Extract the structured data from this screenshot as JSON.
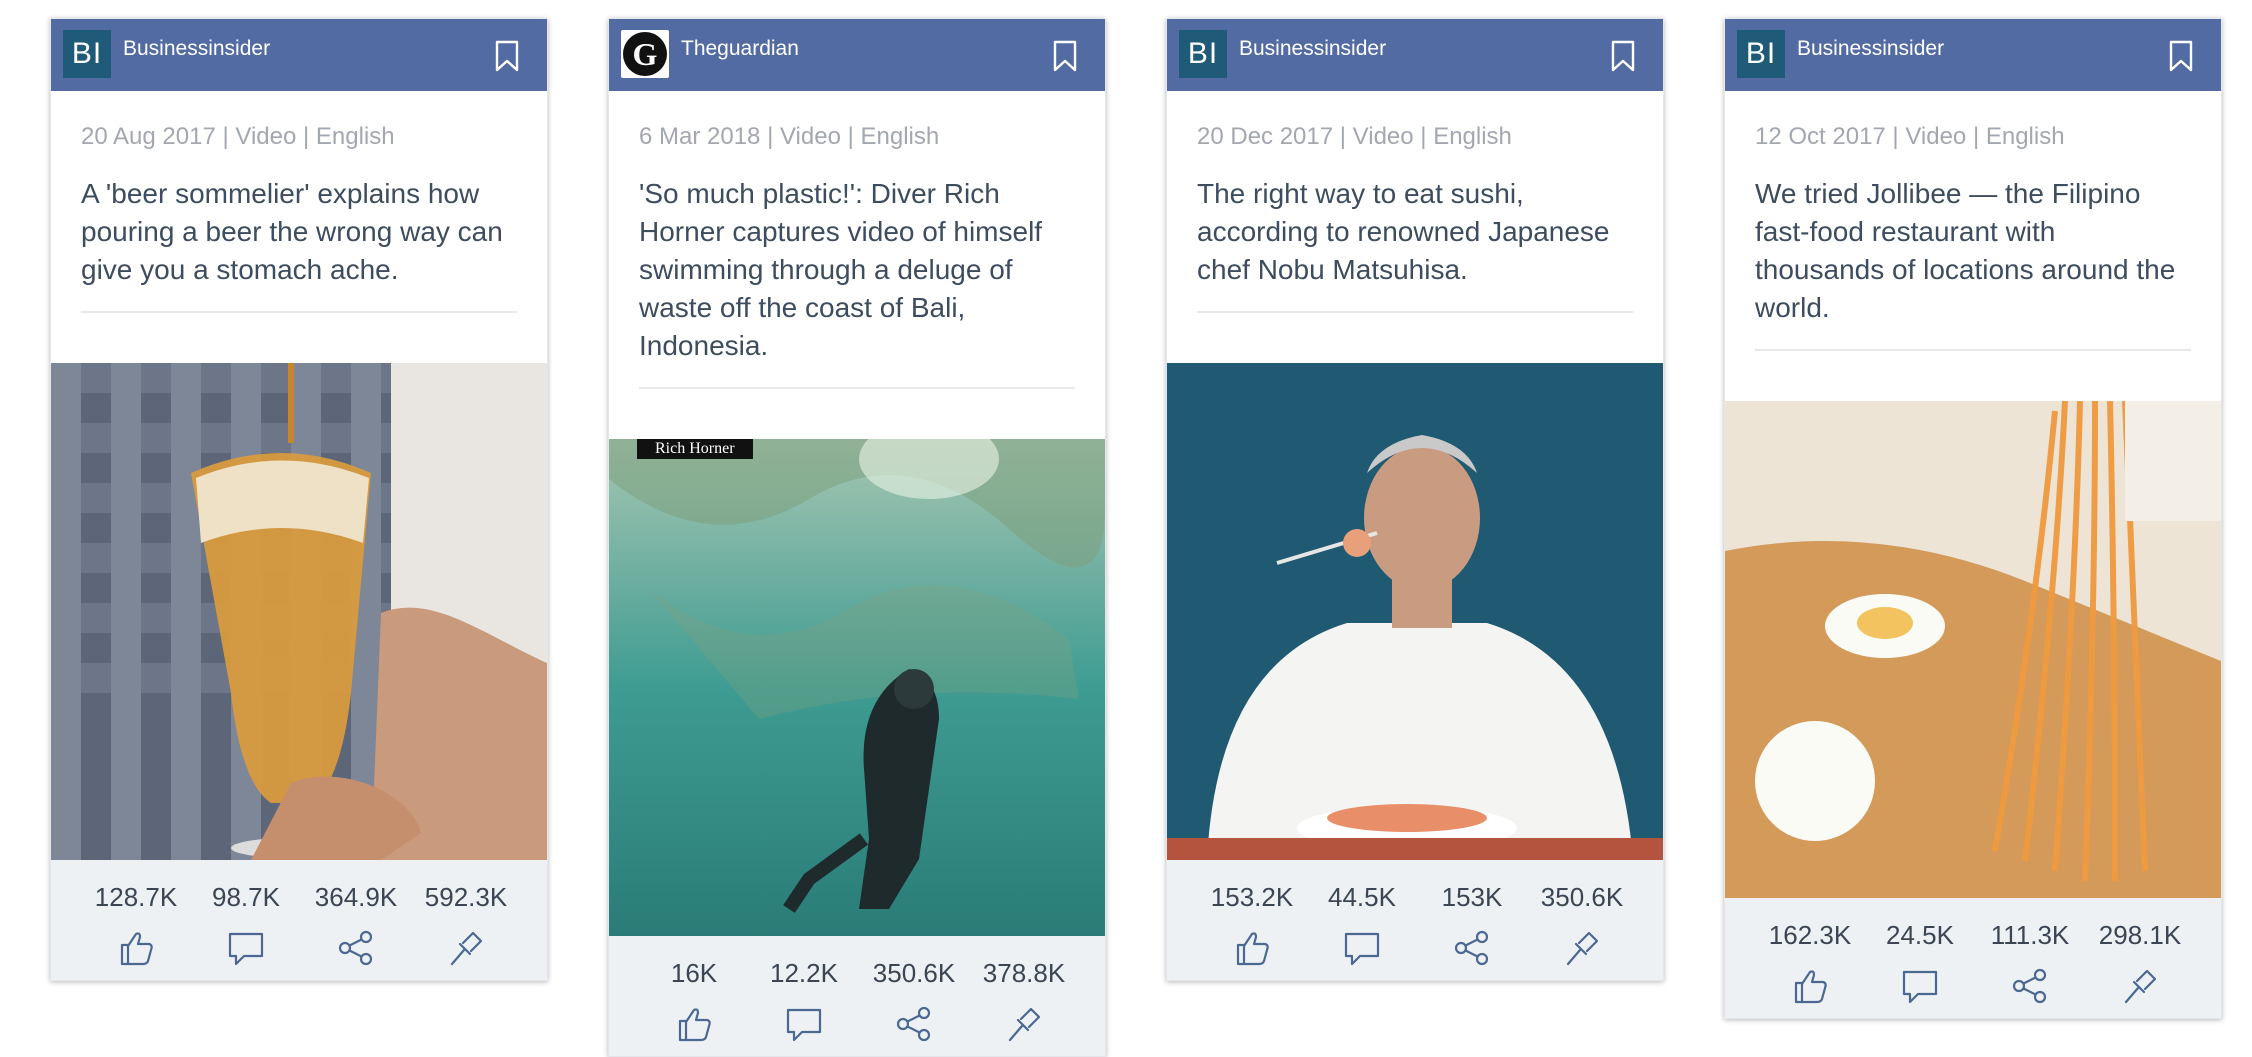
{
  "colors": {
    "header": "#536ba3",
    "bi_logo": "#1f5b79",
    "meta": "#a2a7b0",
    "title": "#3d4c5e",
    "footer": "#eef1f4",
    "icon": "#4a6892"
  },
  "cards": [
    {
      "logo": "BI",
      "source": "Businessinsider",
      "meta": "20 Aug 2017 | Video | English",
      "title": "A 'beer sommelier' explains how pouring a beer the wrong way can give you a stomach ache.",
      "image": "beer-glass-photo",
      "stats": {
        "likes": "128.7K",
        "comments": "98.7K",
        "shares": "364.9K",
        "pins": "592.3K"
      }
    },
    {
      "logo": "G",
      "source": "Theguardian",
      "meta": "6 Mar 2018 | Video | English",
      "title": "'So much plastic!': Diver Rich Horner captures video of himself swimming through a deluge of waste off the coast of Bali, Indonesia.",
      "image": "diver-underwater-photo",
      "watermark": "Rich Horner",
      "stats": {
        "likes": "16K",
        "comments": "12.2K",
        "shares": "350.6K",
        "pins": "378.8K"
      }
    },
    {
      "logo": "BI",
      "source": "Businessinsider",
      "meta": "20 Dec 2017 | Video | English",
      "title": "The right way to eat sushi, according to renowned Japanese chef Nobu Matsuhisa.",
      "image": "chef-with-sushi-photo",
      "stats": {
        "likes": "153.2K",
        "comments": "44.5K",
        "shares": "153K",
        "pins": "350.6K"
      }
    },
    {
      "logo": "BI",
      "source": "Businessinsider",
      "meta": "12 Oct 2017 | Video | English",
      "title": "We tried Jollibee — the Filipino fast-food restaurant with thousands of locations around the world.",
      "image": "spaghetti-noodles-photo",
      "stats": {
        "likes": "162.3K",
        "comments": "24.5K",
        "shares": "111.3K",
        "pins": "298.1K"
      }
    }
  ]
}
